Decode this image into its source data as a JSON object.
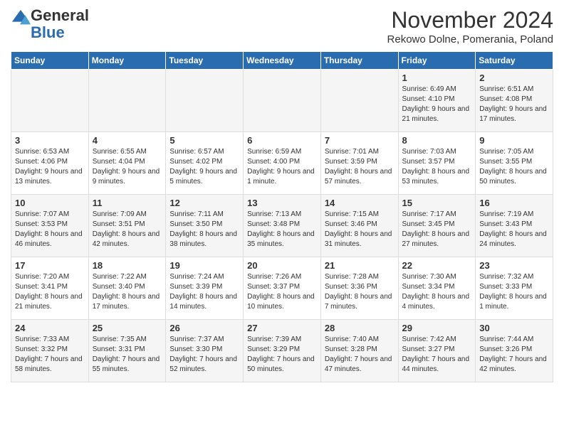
{
  "logo": {
    "general": "General",
    "blue": "Blue"
  },
  "title": "November 2024",
  "subtitle": "Rekowo Dolne, Pomerania, Poland",
  "headers": [
    "Sunday",
    "Monday",
    "Tuesday",
    "Wednesday",
    "Thursday",
    "Friday",
    "Saturday"
  ],
  "weeks": [
    [
      {
        "day": "",
        "info": ""
      },
      {
        "day": "",
        "info": ""
      },
      {
        "day": "",
        "info": ""
      },
      {
        "day": "",
        "info": ""
      },
      {
        "day": "",
        "info": ""
      },
      {
        "day": "1",
        "info": "Sunrise: 6:49 AM\nSunset: 4:10 PM\nDaylight: 9 hours and 21 minutes."
      },
      {
        "day": "2",
        "info": "Sunrise: 6:51 AM\nSunset: 4:08 PM\nDaylight: 9 hours and 17 minutes."
      }
    ],
    [
      {
        "day": "3",
        "info": "Sunrise: 6:53 AM\nSunset: 4:06 PM\nDaylight: 9 hours and 13 minutes."
      },
      {
        "day": "4",
        "info": "Sunrise: 6:55 AM\nSunset: 4:04 PM\nDaylight: 9 hours and 9 minutes."
      },
      {
        "day": "5",
        "info": "Sunrise: 6:57 AM\nSunset: 4:02 PM\nDaylight: 9 hours and 5 minutes."
      },
      {
        "day": "6",
        "info": "Sunrise: 6:59 AM\nSunset: 4:00 PM\nDaylight: 9 hours and 1 minute."
      },
      {
        "day": "7",
        "info": "Sunrise: 7:01 AM\nSunset: 3:59 PM\nDaylight: 8 hours and 57 minutes."
      },
      {
        "day": "8",
        "info": "Sunrise: 7:03 AM\nSunset: 3:57 PM\nDaylight: 8 hours and 53 minutes."
      },
      {
        "day": "9",
        "info": "Sunrise: 7:05 AM\nSunset: 3:55 PM\nDaylight: 8 hours and 50 minutes."
      }
    ],
    [
      {
        "day": "10",
        "info": "Sunrise: 7:07 AM\nSunset: 3:53 PM\nDaylight: 8 hours and 46 minutes."
      },
      {
        "day": "11",
        "info": "Sunrise: 7:09 AM\nSunset: 3:51 PM\nDaylight: 8 hours and 42 minutes."
      },
      {
        "day": "12",
        "info": "Sunrise: 7:11 AM\nSunset: 3:50 PM\nDaylight: 8 hours and 38 minutes."
      },
      {
        "day": "13",
        "info": "Sunrise: 7:13 AM\nSunset: 3:48 PM\nDaylight: 8 hours and 35 minutes."
      },
      {
        "day": "14",
        "info": "Sunrise: 7:15 AM\nSunset: 3:46 PM\nDaylight: 8 hours and 31 minutes."
      },
      {
        "day": "15",
        "info": "Sunrise: 7:17 AM\nSunset: 3:45 PM\nDaylight: 8 hours and 27 minutes."
      },
      {
        "day": "16",
        "info": "Sunrise: 7:19 AM\nSunset: 3:43 PM\nDaylight: 8 hours and 24 minutes."
      }
    ],
    [
      {
        "day": "17",
        "info": "Sunrise: 7:20 AM\nSunset: 3:41 PM\nDaylight: 8 hours and 21 minutes."
      },
      {
        "day": "18",
        "info": "Sunrise: 7:22 AM\nSunset: 3:40 PM\nDaylight: 8 hours and 17 minutes."
      },
      {
        "day": "19",
        "info": "Sunrise: 7:24 AM\nSunset: 3:39 PM\nDaylight: 8 hours and 14 minutes."
      },
      {
        "day": "20",
        "info": "Sunrise: 7:26 AM\nSunset: 3:37 PM\nDaylight: 8 hours and 10 minutes."
      },
      {
        "day": "21",
        "info": "Sunrise: 7:28 AM\nSunset: 3:36 PM\nDaylight: 8 hours and 7 minutes."
      },
      {
        "day": "22",
        "info": "Sunrise: 7:30 AM\nSunset: 3:34 PM\nDaylight: 8 hours and 4 minutes."
      },
      {
        "day": "23",
        "info": "Sunrise: 7:32 AM\nSunset: 3:33 PM\nDaylight: 8 hours and 1 minute."
      }
    ],
    [
      {
        "day": "24",
        "info": "Sunrise: 7:33 AM\nSunset: 3:32 PM\nDaylight: 7 hours and 58 minutes."
      },
      {
        "day": "25",
        "info": "Sunrise: 7:35 AM\nSunset: 3:31 PM\nDaylight: 7 hours and 55 minutes."
      },
      {
        "day": "26",
        "info": "Sunrise: 7:37 AM\nSunset: 3:30 PM\nDaylight: 7 hours and 52 minutes."
      },
      {
        "day": "27",
        "info": "Sunrise: 7:39 AM\nSunset: 3:29 PM\nDaylight: 7 hours and 50 minutes."
      },
      {
        "day": "28",
        "info": "Sunrise: 7:40 AM\nSunset: 3:28 PM\nDaylight: 7 hours and 47 minutes."
      },
      {
        "day": "29",
        "info": "Sunrise: 7:42 AM\nSunset: 3:27 PM\nDaylight: 7 hours and 44 minutes."
      },
      {
        "day": "30",
        "info": "Sunrise: 7:44 AM\nSunset: 3:26 PM\nDaylight: 7 hours and 42 minutes."
      }
    ]
  ]
}
